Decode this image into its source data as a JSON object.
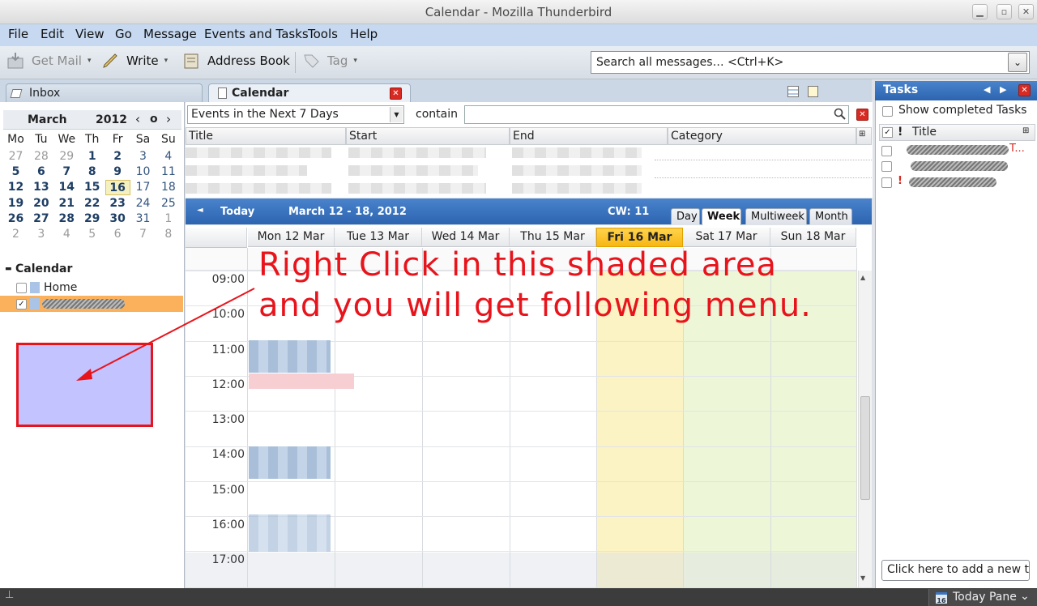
{
  "window": {
    "title": "Calendar - Mozilla Thunderbird"
  },
  "menubar": [
    "File",
    "Edit",
    "View",
    "Go",
    "Message",
    "Events and Tasks",
    "Tools",
    "Help"
  ],
  "toolbar": {
    "get_mail": "Get Mail",
    "write": "Write",
    "address_book": "Address Book",
    "tag": "Tag"
  },
  "search": {
    "placeholder": "Search all messages… <Ctrl+K>"
  },
  "tabs": [
    {
      "label": "Inbox"
    },
    {
      "label": "Calendar"
    }
  ],
  "minimonth": {
    "month": "March",
    "year": "2012",
    "weekdays": [
      "Mo",
      "Tu",
      "We",
      "Th",
      "Fr",
      "Sa",
      "Su"
    ],
    "rows": [
      [
        "27",
        "28",
        "29",
        "1",
        "2",
        "3",
        "4"
      ],
      [
        "5",
        "6",
        "7",
        "8",
        "9",
        "10",
        "11"
      ],
      [
        "12",
        "13",
        "14",
        "15",
        "16",
        "17",
        "18"
      ],
      [
        "19",
        "20",
        "21",
        "22",
        "23",
        "24",
        "25"
      ],
      [
        "26",
        "27",
        "28",
        "29",
        "30",
        "31",
        "1"
      ],
      [
        "2",
        "3",
        "4",
        "5",
        "6",
        "7",
        "8"
      ]
    ],
    "today": "16"
  },
  "calendars": {
    "heading": "Calendar",
    "items": [
      {
        "name": "Home",
        "checked": false
      }
    ]
  },
  "events_filter": {
    "selected": "Events in the Next 7 Days",
    "contain_label": "contain"
  },
  "event_columns": [
    "Title",
    "Start",
    "End",
    "Category"
  ],
  "calbar": {
    "today": "Today",
    "range": "March 12 - 18, 2012",
    "cw": "CW: 11"
  },
  "view_tabs": [
    "Day",
    "Week",
    "Multiweek",
    "Month"
  ],
  "selected_view": "Week",
  "days": [
    "Mon 12 Mar",
    "Tue 13 Mar",
    "Wed 14 Mar",
    "Thu 15 Mar",
    "Fri 16 Mar",
    "Sat 17 Mar",
    "Sun 18 Mar"
  ],
  "hours": [
    "09:00",
    "10:00",
    "11:00",
    "12:00",
    "13:00",
    "14:00",
    "15:00",
    "16:00",
    "17:00"
  ],
  "tasks": {
    "title": "Tasks",
    "show_completed": "Show completed Tasks",
    "col_title": "Title",
    "add_placeholder": "Click here to add a new task"
  },
  "status": {
    "today_pane": "Today Pane",
    "day_badge": "16"
  },
  "annotation": {
    "line1": "Right Click in this shaded area",
    "line2": "and you will get following menu."
  },
  "colors": {
    "accent": "#3b74c0",
    "today_highlight": "#ffcc33",
    "weekend": "#eef6d8",
    "annotation": "#e8141c"
  }
}
